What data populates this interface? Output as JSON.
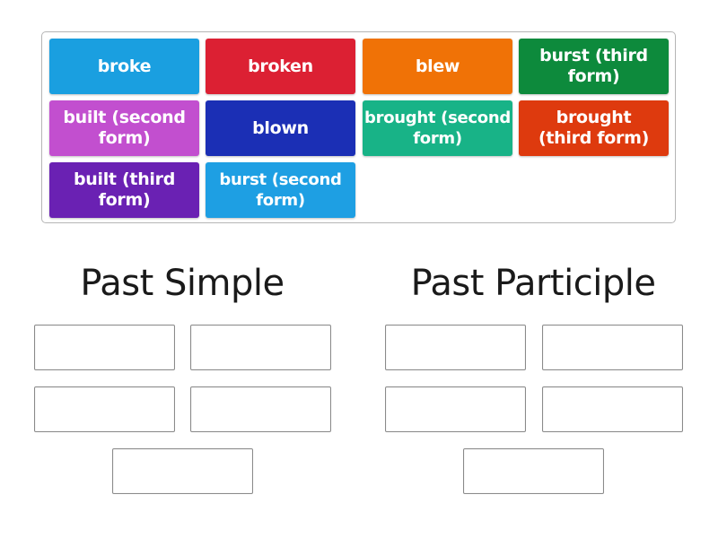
{
  "tile_bank": {
    "tiles": [
      {
        "label": "broke",
        "color": "#1a9fe0"
      },
      {
        "label": "broken",
        "color": "#dc2033"
      },
      {
        "label": "blew",
        "color": "#f07206"
      },
      {
        "label": "burst (third form)",
        "color": "#0d8a3c"
      },
      {
        "label": "built (second form)",
        "color": "#c24fcf"
      },
      {
        "label": "blown",
        "color": "#1b2fb5"
      },
      {
        "label": "brought (second form)",
        "color": "#18b387"
      },
      {
        "label": "brought (third form)",
        "color": "#de3a0e"
      },
      {
        "label": "built (third form)",
        "color": "#6a21b3"
      },
      {
        "label": "burst (second form)",
        "color": "#1e9fe3"
      }
    ]
  },
  "groups": [
    {
      "title": "Past Simple",
      "slot_count": 5
    },
    {
      "title": "Past Participle",
      "slot_count": 5
    }
  ]
}
